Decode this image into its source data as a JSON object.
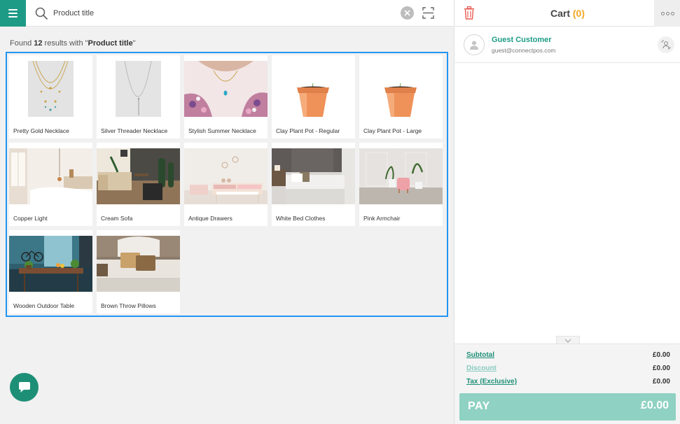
{
  "search": {
    "value": "Product title",
    "results_prefix": "Found ",
    "results_count": "12",
    "results_middle": " results with \"",
    "results_query": "Product title",
    "results_suffix": "\""
  },
  "products": [
    {
      "name": "Pretty Gold Necklace"
    },
    {
      "name": "Silver Threader Necklace"
    },
    {
      "name": "Stylish Summer Necklace"
    },
    {
      "name": "Clay Plant Pot - Regular"
    },
    {
      "name": "Clay Plant Pot - Large"
    },
    {
      "name": "Copper Light"
    },
    {
      "name": "Cream Sofa"
    },
    {
      "name": "Antique Drawers"
    },
    {
      "name": "White Bed Clothes"
    },
    {
      "name": "Pink Armchair"
    },
    {
      "name": "Wooden Outdoor Table"
    },
    {
      "name": "Brown Throw Pillows"
    }
  ],
  "cart": {
    "title": "Cart",
    "count": "(0)",
    "customer": {
      "name": "Guest Customer",
      "email": "guest@connectpos.com"
    },
    "totals": {
      "subtotal_label": "Subtotal",
      "subtotal_value": "£0.00",
      "discount_label": "Discount",
      "discount_value": "£0.00",
      "tax_label": "Tax (Exclusive)",
      "tax_value": "£0.00"
    },
    "pay_label": "PAY",
    "pay_amount": "£0.00"
  },
  "colors": {
    "brand_teal": "#1d9b86",
    "selection_blue": "#2196f3",
    "cart_count_orange": "#f5a623",
    "pay_button": "#8fd1c2",
    "trash_red": "#e85a4f"
  },
  "icons": [
    "menu-icon",
    "search-icon",
    "clear-icon",
    "barcode-scan-icon",
    "trash-icon",
    "more-options-icon",
    "user-avatar-icon",
    "switch-customer-icon",
    "chevron-down-icon",
    "chat-icon"
  ]
}
